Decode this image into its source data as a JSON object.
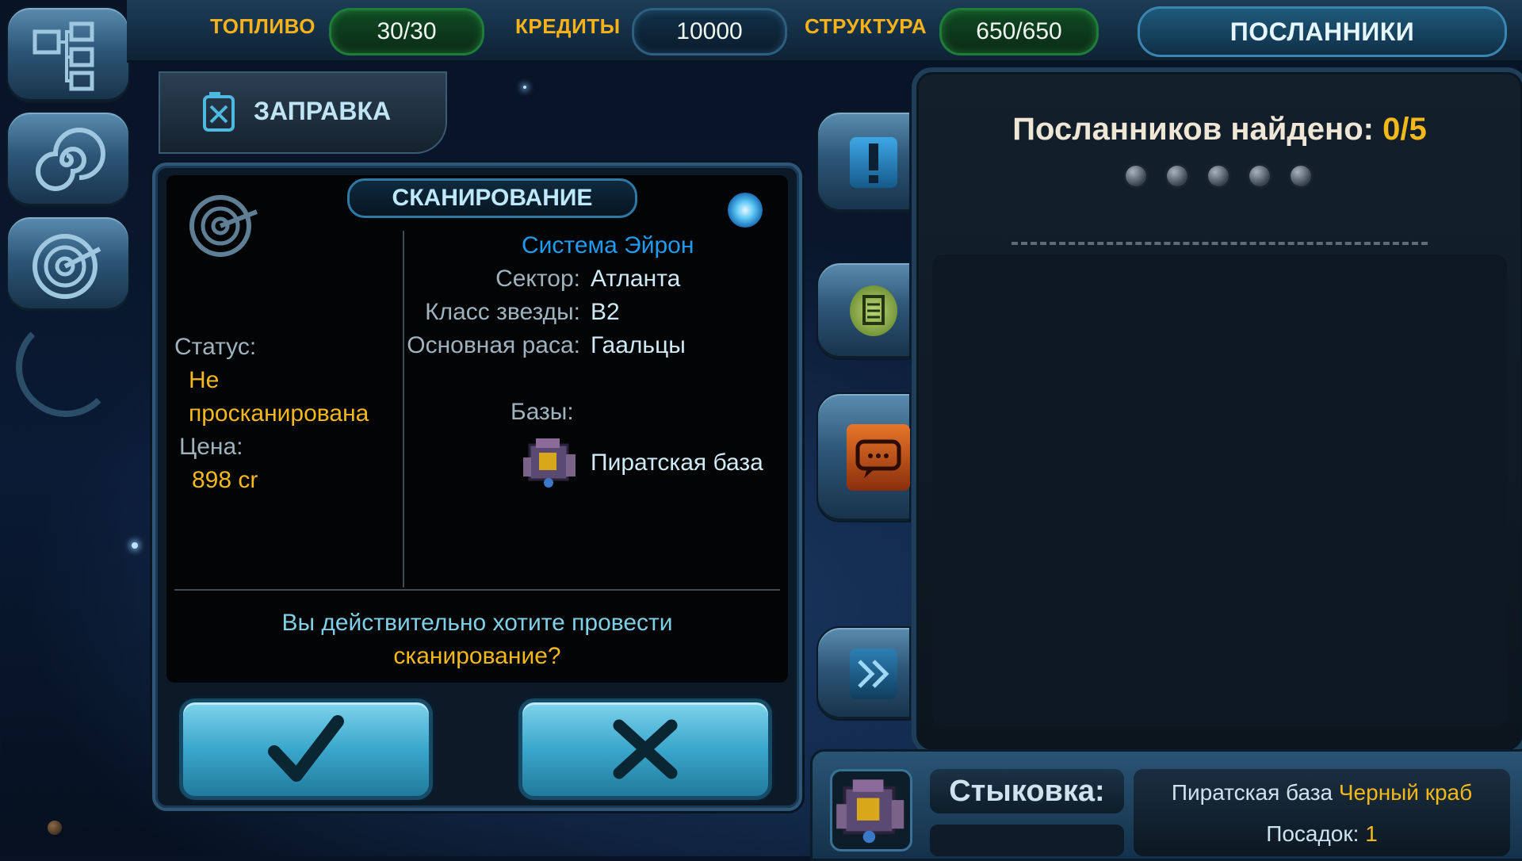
{
  "resources": {
    "fuel_label": "ТОПЛИВО",
    "fuel_value": "30/30",
    "credits_label": "КРЕДИТЫ",
    "credits_value": "10000",
    "structure_label": "СТРУКТУРА",
    "structure_value": "650/650"
  },
  "tabs": {
    "envoys": "ПОСЛАННИКИ",
    "refuel": "ЗАПРАВКА"
  },
  "scan": {
    "title": "СКАНИРОВАНИЕ",
    "status_label": "Статус:",
    "status_value_line1": "Не",
    "status_value_line2": "просканирована",
    "price_label": "Цена:",
    "price_value": "898 cr",
    "system_name": "Система Эйрон",
    "sector_label": "Сектор:",
    "sector_value": "Атланта",
    "star_class_label": "Класс звезды:",
    "star_class_value": "B2",
    "race_label": "Основная раса:",
    "race_value": "Гаальцы",
    "bases_label": "Базы:",
    "base_name": "Пиратская база",
    "question_line1": "Вы действительно хотите провести",
    "question_line2": "сканирование?",
    "confirm_icon": "checkmark-icon",
    "cancel_icon": "cross-icon"
  },
  "envoys": {
    "found_label": "Посланников найдено:",
    "found_value": "0/5",
    "slots": 5
  },
  "docking": {
    "label": "Стыковка:",
    "base_type": "Пиратская база",
    "base_name": "Черный краб",
    "landings_label": "Посадок:",
    "landings_value": "1"
  },
  "colors": {
    "accent_yellow": "#f3b81a",
    "system_blue": "#1f9cf0",
    "panel_border": "#2d5677"
  }
}
